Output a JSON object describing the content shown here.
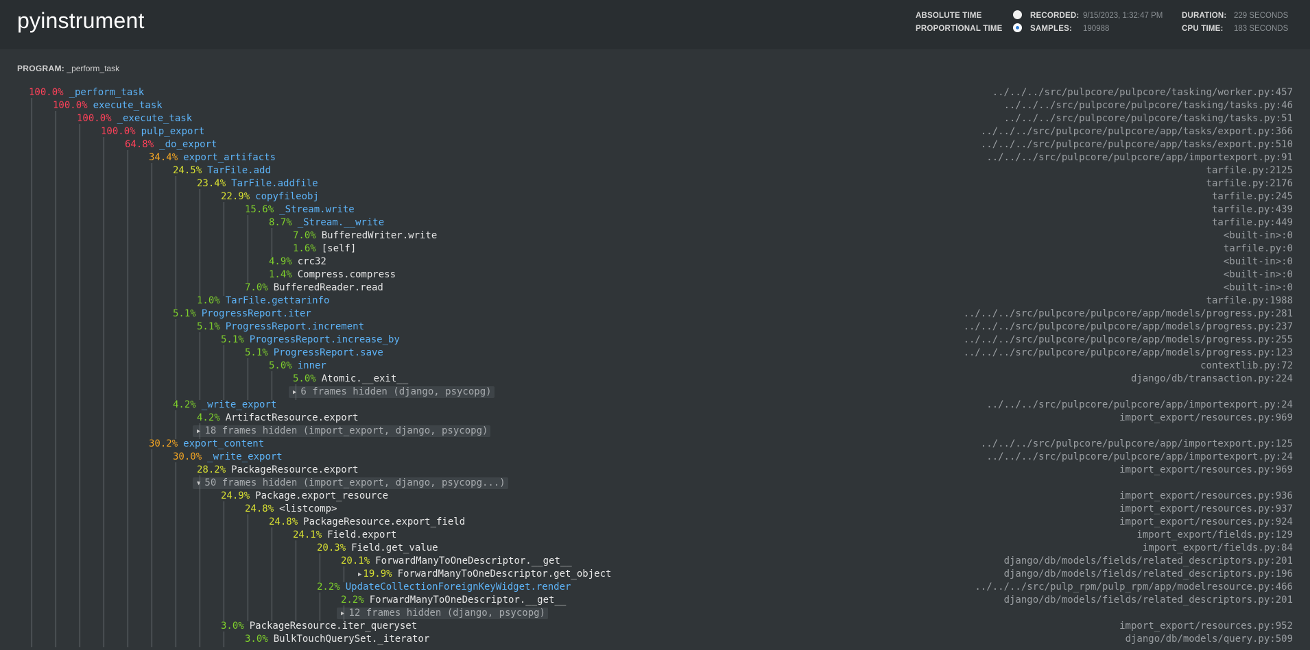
{
  "app": {
    "title": "pyinstrument"
  },
  "meta": {
    "absolute_time_label": "ABSOLUTE TIME",
    "proportional_time_label": "PROPORTIONAL TIME",
    "recorded_label": "RECORDED:",
    "recorded_value": "9/15/2023, 1:32:47 PM",
    "samples_label": "SAMPLES:",
    "samples_value": "190988",
    "duration_label": "DURATION:",
    "duration_value": "229 SECONDS",
    "cpu_time_label": "CPU TIME:",
    "cpu_time_value": "183 SECONDS",
    "selected_mode": "proportional"
  },
  "program": {
    "label": "PROGRAM:",
    "value": "_perform_task"
  },
  "colors": {
    "red": "#ff4159",
    "orange": "#f5a623",
    "yellow": "#d8e032",
    "green": "#7fd12c",
    "app_function": "#5db3f7",
    "library_function": "#e6e6e6"
  },
  "frames": [
    {
      "pct": "100.0%",
      "name": "_perform_task",
      "loc": "../../../src/pulpcore/pulpcore/tasking/worker.py:457",
      "depth": 0,
      "color": "red",
      "app": true
    },
    {
      "pct": "100.0%",
      "name": "execute_task",
      "loc": "../../../src/pulpcore/pulpcore/tasking/tasks.py:46",
      "depth": 1,
      "color": "red",
      "app": true
    },
    {
      "pct": "100.0%",
      "name": "_execute_task",
      "loc": "../../../src/pulpcore/pulpcore/tasking/tasks.py:51",
      "depth": 2,
      "color": "red",
      "app": true
    },
    {
      "pct": "100.0%",
      "name": "pulp_export",
      "loc": "../../../src/pulpcore/pulpcore/app/tasks/export.py:366",
      "depth": 3,
      "color": "red",
      "app": true
    },
    {
      "pct": "64.8%",
      "name": "_do_export",
      "loc": "../../../src/pulpcore/pulpcore/app/tasks/export.py:510",
      "depth": 4,
      "color": "red",
      "app": true
    },
    {
      "pct": "34.4%",
      "name": "export_artifacts",
      "loc": "../../../src/pulpcore/pulpcore/app/importexport.py:91",
      "depth": 5,
      "color": "orange",
      "app": true
    },
    {
      "pct": "24.5%",
      "name": "TarFile.add",
      "loc": "tarfile.py:2125",
      "depth": 6,
      "color": "yellow",
      "app": true
    },
    {
      "pct": "23.4%",
      "name": "TarFile.addfile",
      "loc": "tarfile.py:2176",
      "depth": 7,
      "color": "yellow",
      "app": true
    },
    {
      "pct": "22.9%",
      "name": "copyfileobj",
      "loc": "tarfile.py:245",
      "depth": 8,
      "color": "yellow",
      "app": true
    },
    {
      "pct": "15.6%",
      "name": "_Stream.write",
      "loc": "tarfile.py:439",
      "depth": 9,
      "color": "green",
      "app": true
    },
    {
      "pct": "8.7%",
      "name": "_Stream.__write",
      "loc": "tarfile.py:449",
      "depth": 10,
      "color": "green",
      "app": true
    },
    {
      "pct": "7.0%",
      "name": "BufferedWriter.write",
      "loc": "<built-in>:0",
      "depth": 11,
      "color": "green",
      "app": false
    },
    {
      "pct": "1.6%",
      "name": "[self]",
      "loc": "tarfile.py:0",
      "depth": 11,
      "color": "green",
      "app": false
    },
    {
      "pct": "4.9%",
      "name": "crc32",
      "loc": "<built-in>:0",
      "depth": 10,
      "color": "green",
      "app": false
    },
    {
      "pct": "1.4%",
      "name": "Compress.compress",
      "loc": "<built-in>:0",
      "depth": 10,
      "color": "green",
      "app": false
    },
    {
      "pct": "7.0%",
      "name": "BufferedReader.read",
      "loc": "<built-in>:0",
      "depth": 9,
      "color": "green",
      "app": false
    },
    {
      "pct": "1.0%",
      "name": "TarFile.gettarinfo",
      "loc": "tarfile.py:1988",
      "depth": 7,
      "color": "green",
      "app": true
    },
    {
      "pct": "5.1%",
      "name": "ProgressReport.iter",
      "loc": "../../../src/pulpcore/pulpcore/app/models/progress.py:281",
      "depth": 6,
      "color": "green",
      "app": true
    },
    {
      "pct": "5.1%",
      "name": "ProgressReport.increment",
      "loc": "../../../src/pulpcore/pulpcore/app/models/progress.py:237",
      "depth": 7,
      "color": "green",
      "app": true
    },
    {
      "pct": "5.1%",
      "name": "ProgressReport.increase_by",
      "loc": "../../../src/pulpcore/pulpcore/app/models/progress.py:255",
      "depth": 8,
      "color": "green",
      "app": true
    },
    {
      "pct": "5.1%",
      "name": "ProgressReport.save",
      "loc": "../../../src/pulpcore/pulpcore/app/models/progress.py:123",
      "depth": 9,
      "color": "green",
      "app": true
    },
    {
      "pct": "5.0%",
      "name": "inner",
      "loc": "contextlib.py:72",
      "depth": 10,
      "color": "green",
      "app": true
    },
    {
      "pct": "5.0%",
      "name": "Atomic.__exit__",
      "loc": "django/db/transaction.py:224",
      "depth": 11,
      "color": "green",
      "app": false
    },
    {
      "hidden": true,
      "text": "6 frames hidden (django, psycopg)",
      "depth": 11,
      "expanded": false
    },
    {
      "pct": "4.2%",
      "name": "_write_export",
      "loc": "../../../src/pulpcore/pulpcore/app/importexport.py:24",
      "depth": 6,
      "color": "green",
      "app": true
    },
    {
      "pct": "4.2%",
      "name": "ArtifactResource.export",
      "loc": "import_export/resources.py:969",
      "depth": 7,
      "color": "green",
      "app": false
    },
    {
      "hidden": true,
      "text": "18 frames hidden (import_export, django, psycopg)",
      "depth": 7,
      "expanded": false
    },
    {
      "pct": "30.2%",
      "name": "export_content",
      "loc": "../../../src/pulpcore/pulpcore/app/importexport.py:125",
      "depth": 5,
      "color": "orange",
      "app": true
    },
    {
      "pct": "30.0%",
      "name": "_write_export",
      "loc": "../../../src/pulpcore/pulpcore/app/importexport.py:24",
      "depth": 6,
      "color": "orange",
      "app": true
    },
    {
      "pct": "28.2%",
      "name": "PackageResource.export",
      "loc": "import_export/resources.py:969",
      "depth": 7,
      "color": "yellow",
      "app": false
    },
    {
      "hidden": true,
      "text": "50 frames hidden (import_export, django, psycopg...)",
      "depth": 7,
      "expanded": true
    },
    {
      "pct": "24.9%",
      "name": "Package.export_resource",
      "loc": "import_export/resources.py:936",
      "depth": 8,
      "color": "yellow",
      "app": false
    },
    {
      "pct": "24.8%",
      "name": "<listcomp>",
      "loc": "import_export/resources.py:937",
      "depth": 9,
      "color": "yellow",
      "app": false
    },
    {
      "pct": "24.8%",
      "name": "PackageResource.export_field",
      "loc": "import_export/resources.py:924",
      "depth": 10,
      "color": "yellow",
      "app": false
    },
    {
      "pct": "24.1%",
      "name": "Field.export",
      "loc": "import_export/fields.py:129",
      "depth": 11,
      "color": "yellow",
      "app": false
    },
    {
      "pct": "20.3%",
      "name": "Field.get_value",
      "loc": "import_export/fields.py:84",
      "depth": 12,
      "color": "yellow",
      "app": false
    },
    {
      "pct": "20.1%",
      "name": "ForwardManyToOneDescriptor.__get__",
      "loc": "django/db/models/fields/related_descriptors.py:201",
      "depth": 13,
      "color": "yellow",
      "app": false
    },
    {
      "pct": "19.9%",
      "name": "ForwardManyToOneDescriptor.get_object",
      "loc": "django/db/models/fields/related_descriptors.py:196",
      "depth": 14,
      "color": "yellow",
      "app": false,
      "collapsed_toggle": true
    },
    {
      "pct": "2.2%",
      "name": "UpdateCollectionForeignKeyWidget.render",
      "loc": "../../../src/pulp_rpm/pulp_rpm/app/modelresource.py:466",
      "depth": 12,
      "color": "green",
      "app": true
    },
    {
      "pct": "2.2%",
      "name": "ForwardManyToOneDescriptor.__get__",
      "loc": "django/db/models/fields/related_descriptors.py:201",
      "depth": 13,
      "color": "green",
      "app": false
    },
    {
      "hidden": true,
      "text": "12 frames hidden (django, psycopg)",
      "depth": 13,
      "expanded": false
    },
    {
      "pct": "3.0%",
      "name": "PackageResource.iter_queryset",
      "loc": "import_export/resources.py:952",
      "depth": 8,
      "color": "green",
      "app": false
    },
    {
      "pct": "3.0%",
      "name": "BulkTouchQuerySet._iterator",
      "loc": "django/db/models/query.py:509",
      "depth": 9,
      "color": "green",
      "app": false
    }
  ]
}
